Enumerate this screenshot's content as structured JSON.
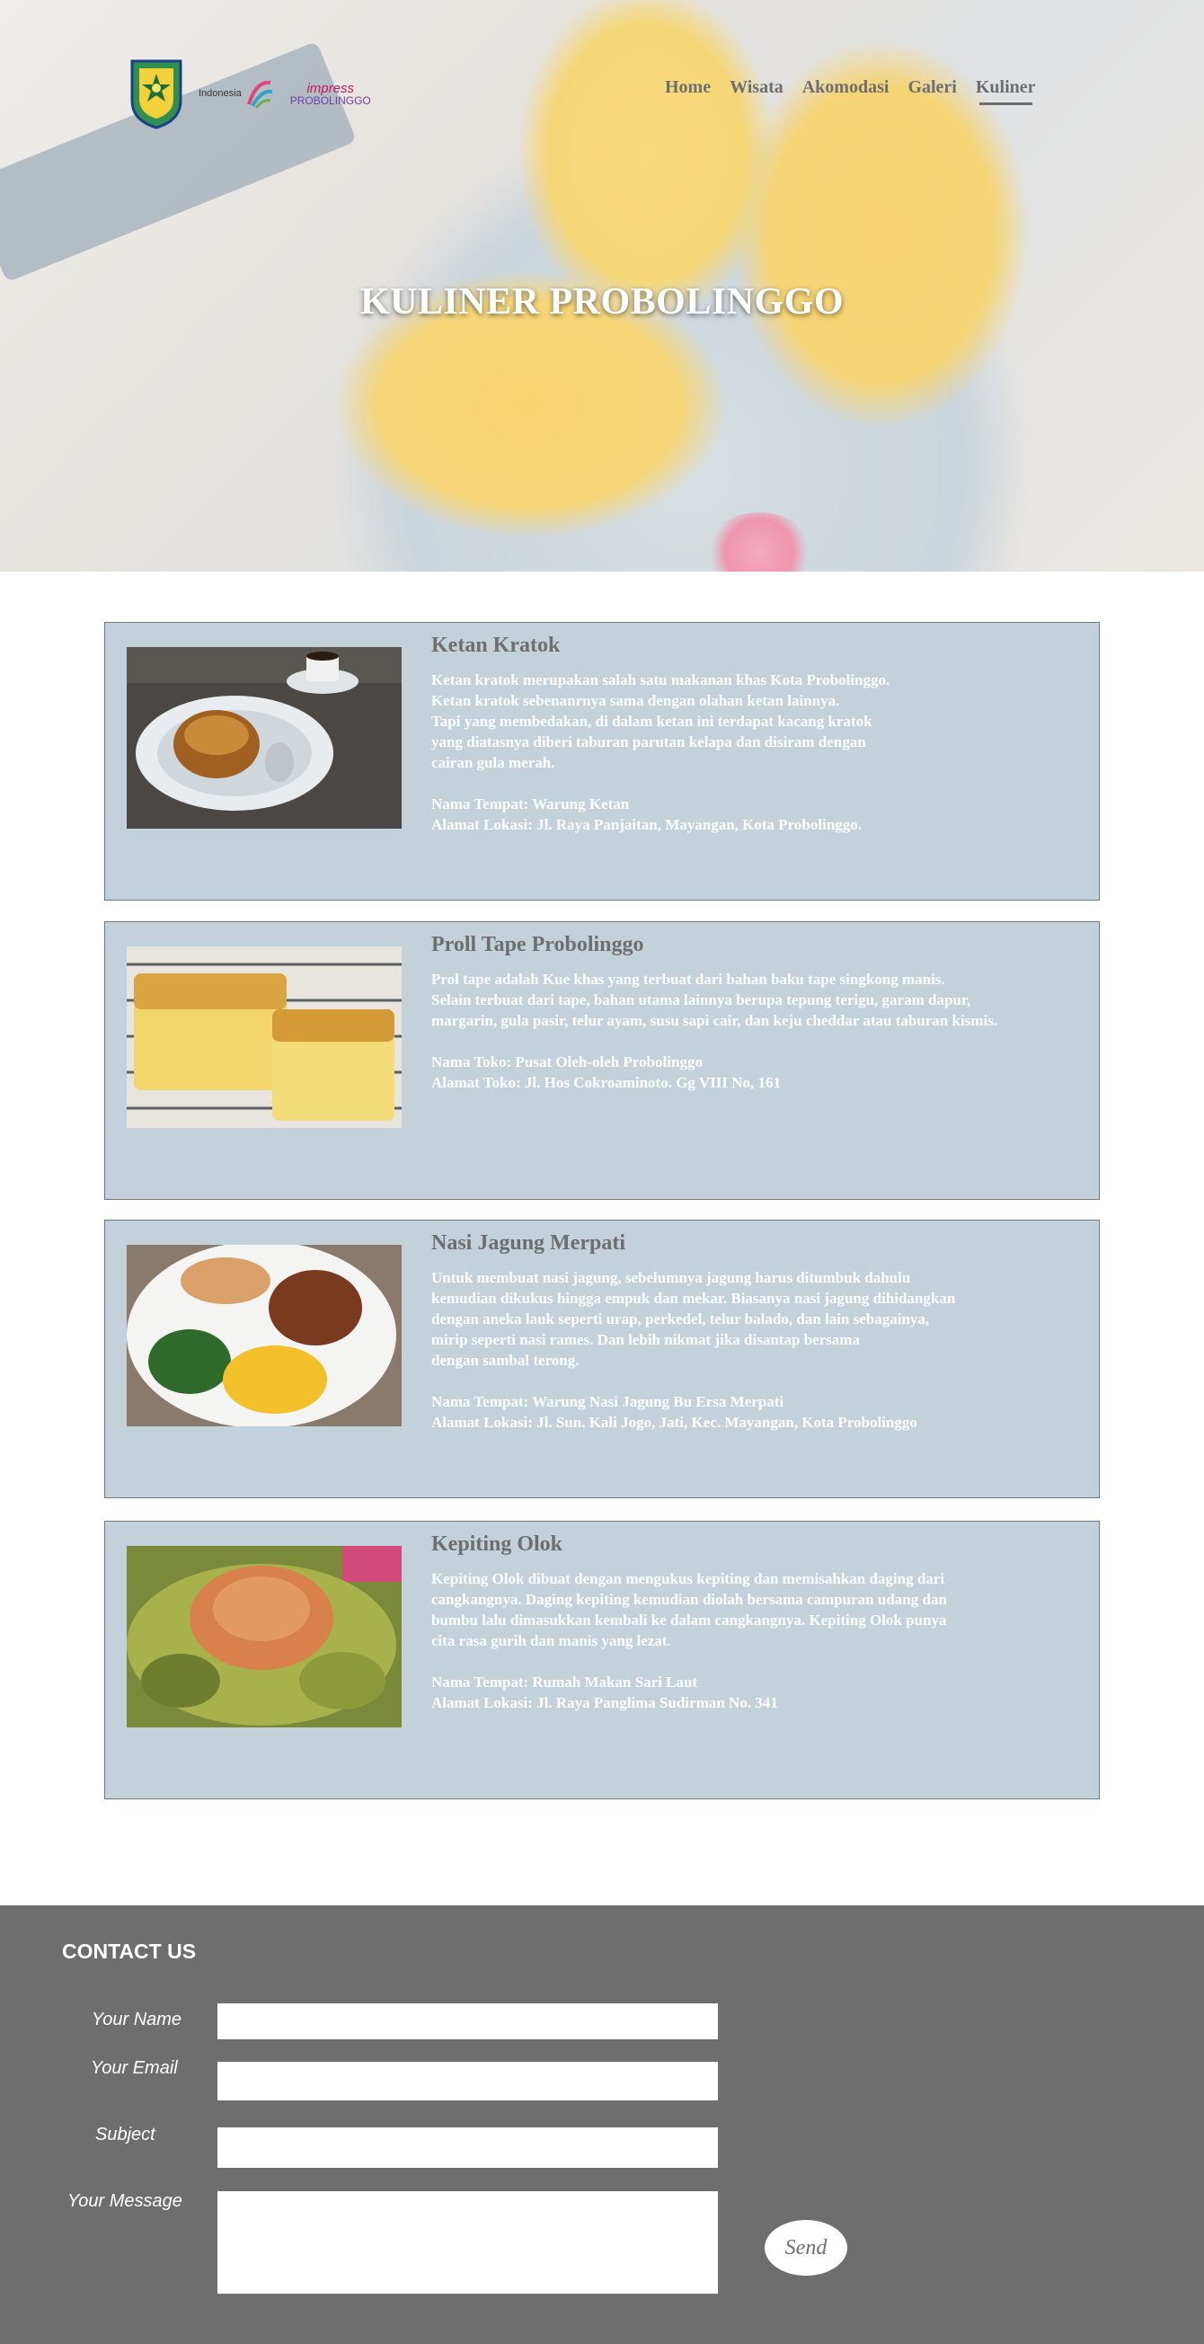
{
  "header": {
    "logo_indonesia_text": "Indonesia",
    "logo_probolinggo_top": "impress",
    "logo_probolinggo_bottom": "PROBOLINGGO",
    "nav": [
      {
        "label": "Home"
      },
      {
        "label": "Wisata"
      },
      {
        "label": "Akomodasi"
      },
      {
        "label": "Galeri"
      },
      {
        "label": "Kuliner"
      }
    ],
    "active_nav": "Kuliner"
  },
  "hero": {
    "title": "KULINER PROBOLINGGO"
  },
  "items": [
    {
      "title": "Ketan Kratok",
      "description": "Ketan kratok merupakan salah satu makanan khas Kota Probolinggo.\nKetan kratok sebenanrnya sama dengan olahan ketan lainnya.\nTapi yang membedakan, di dalam ketan ini terdapat kacang kratok\nyang diatasnya diberi taburan parutan kelapa dan disiram dengan\ncairan gula merah.",
      "place": "Nama Tempat: Warung Ketan",
      "address": "Alamat Lokasi: Jl. Raya Panjaitan, Mayangan, Kota Probolinggo."
    },
    {
      "title": "Proll Tape Probolinggo",
      "description": "Prol tape adalah Kue khas yang terbuat dari bahan baku tape singkong manis.\nSelain terbuat dari tape, bahan utama lainnya berupa tepung terigu, garam dapur,\nmargarin, gula pasir, telur ayam, susu sapi cair, dan keju cheddar atau taburan kismis.",
      "place": "Nama Toko: Pusat Oleh-oleh Probolinggo",
      "address": "Alamat Toko: Jl. Hos Cokroaminoto. Gg VIII No, 161"
    },
    {
      "title": "Nasi Jagung Merpati",
      "description": "Untuk membuat nasi jagung, sebelumnya jagung harus ditumbuk dahulu\nkemudian dikukus hingga empuk dan mekar. Biasanya nasi jagung dihidangkan\ndengan aneka lauk seperti urap, perkedel, telur balado, dan lain sebagainya,\nmirip seperti nasi rames. Dan lebih nikmat jika disantap bersama\ndengan sambal terong.",
      "place": "Nama Tempat: Warung Nasi Jagung Bu Ersa Merpati",
      "address": "Alamat Lokasi: Jl. Sun. Kali Jogo, Jati, Kec. Mayangan, Kota Probolinggo"
    },
    {
      "title": "Kepiting Olok",
      "description": "Kepiting Olok dibuat dengan mengukus kepiting dan memisahkan daging dari\ncangkangnya. Daging kepiting kemudian diolah bersama campuran udang dan\nbumbu lalu dimasukkan kembali ke dalam cangkangnya. Kepiting Olok punya\ncita rasa gurih dan manis yang lezat.",
      "place": "Nama Tempat: Rumah Makan Sari Laut",
      "address": "Alamat Lokasi: Jl. Raya Panglima Sudirman No. 341"
    }
  ],
  "contact": {
    "title": "CONTACT US",
    "name_label": "Your Name",
    "email_label": "Your Email",
    "subject_label": "Subject",
    "message_label": "Your Message",
    "name_value": "",
    "email_value": "",
    "subject_value": "",
    "message_value": "",
    "send_label": "Send"
  }
}
